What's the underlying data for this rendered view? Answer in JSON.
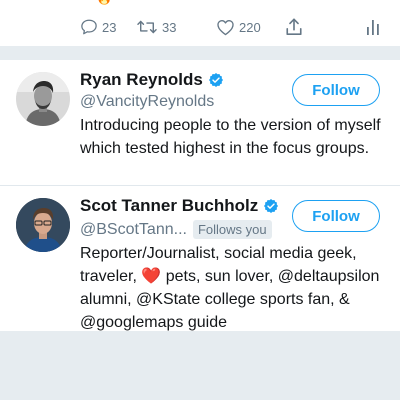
{
  "previous_tweet": {
    "actions": {
      "reply_count": "23",
      "retweet_count": "33",
      "like_count": "220"
    },
    "icons": [
      "reply-icon",
      "retweet-icon",
      "like-icon",
      "share-icon",
      "analytics-icon"
    ]
  },
  "users": [
    {
      "name": "Ryan Reynolds",
      "handle": "@VancityReynolds",
      "verified": true,
      "follows_you": "",
      "bio": "Introducing people to the version of myself which tested highest in the focus groups.",
      "follow_label": "Follow"
    },
    {
      "name": "Scot Tanner Buchholz",
      "handle": "@BScotTann...",
      "verified": true,
      "follows_you": "Follows you",
      "bio_before_heart": "Reporter/Journalist, social media geek, traveler, ",
      "bio_heart": "❤️",
      "bio_after_heart": " pets, sun lover, @deltaupsilon alumni, @KState college sports fan, & @googlemaps guide",
      "follow_label": "Follow"
    }
  ],
  "colors": {
    "accent": "#1da1f2",
    "muted": "#657786",
    "background": "#e6ecf0",
    "heart": "#e0245e"
  }
}
